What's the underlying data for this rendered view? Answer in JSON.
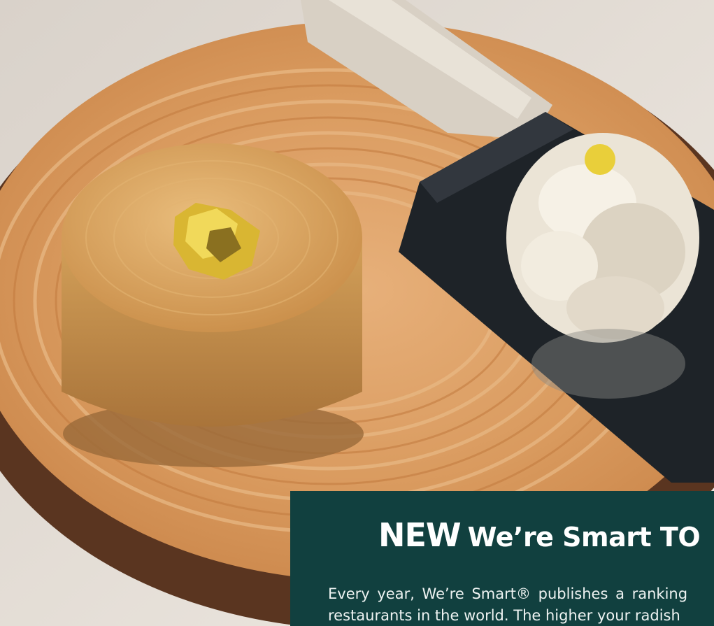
{
  "hero": {
    "image_name": "dessert-on-wood-slice-photo",
    "colors": {
      "wood": "#d79a62",
      "bark": "#5a3520",
      "dessert": "#c98d45",
      "gold_leaf": "#d9b632",
      "cream": "#ebe4d6",
      "slate": "#1e2328",
      "background": "#e8e2da"
    }
  },
  "promo": {
    "new_tag": "NEW",
    "headline": "We’re Smart  TO",
    "body_line1": "Every year, We’re Smart® publishes a ranking",
    "body_line2": "restaurants in the world. The higher your radish",
    "background_color": "#11403f"
  }
}
